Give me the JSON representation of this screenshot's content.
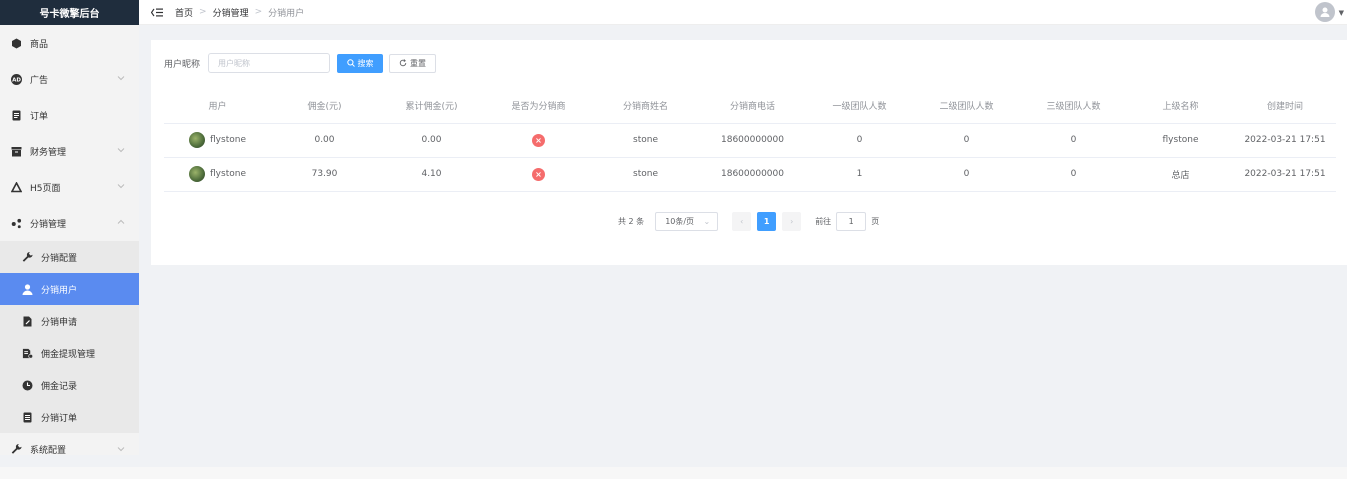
{
  "app": {
    "title": "号卡微擎后台"
  },
  "sidebar": {
    "items": [
      {
        "label": "商品",
        "icon": "cube-icon"
      },
      {
        "label": "广告",
        "icon": "ad-icon"
      },
      {
        "label": "订单",
        "icon": "clipboard-icon"
      },
      {
        "label": "财务管理",
        "icon": "wallet-icon"
      },
      {
        "label": "H5页面",
        "icon": "h5-icon"
      },
      {
        "label": "分销管理",
        "icon": "share-icon"
      }
    ],
    "sub_items": [
      {
        "label": "分销配置",
        "icon": "wrench-icon"
      },
      {
        "label": "分销用户",
        "icon": "user-icon"
      },
      {
        "label": "分销申请",
        "icon": "edit-doc-icon"
      },
      {
        "label": "佣金提现管理",
        "icon": "withdraw-doc-icon"
      },
      {
        "label": "佣金记录",
        "icon": "clock-icon"
      },
      {
        "label": "分销订单",
        "icon": "list-doc-icon"
      }
    ],
    "bottom_item": {
      "label": "系统配置",
      "icon": "wrench-icon"
    }
  },
  "breadcrumb": [
    "首页",
    "分销管理",
    "分销用户"
  ],
  "filter": {
    "label": "用户昵称",
    "placeholder": "用户昵称",
    "search_label": "搜索",
    "reset_label": "重置"
  },
  "table": {
    "headers": [
      "用户",
      "佣金(元)",
      "累计佣金(元)",
      "是否为分销商",
      "分销商姓名",
      "分销商电话",
      "一级团队人数",
      "二级团队人数",
      "三级团队人数",
      "上级名称",
      "创建时间"
    ],
    "rows": [
      [
        "flystone",
        "0.00",
        "0.00",
        "×",
        "stone",
        "18600000000",
        "0",
        "0",
        "0",
        "flystone",
        "2022-03-21 17:51"
      ],
      [
        "flystone",
        "73.90",
        "4.10",
        "×",
        "stone",
        "18600000000",
        "1",
        "0",
        "0",
        "总店",
        "2022-03-21 17:51"
      ]
    ]
  },
  "pagination": {
    "total": "共 2 条",
    "page_size": "10条/页",
    "current_page": "1",
    "goto_label": "前往",
    "goto_value": "1",
    "page_unit": "页"
  },
  "colors": {
    "accent": "#409eff",
    "active_menu": "#5a8bf0",
    "danger": "#f56c6c",
    "header_dark": "#1f2d3d"
  }
}
